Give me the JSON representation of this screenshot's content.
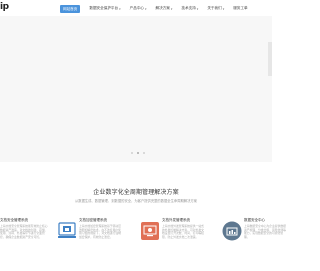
{
  "header": {
    "logo": "ip",
    "nav": [
      {
        "label": "网站首页",
        "active": true,
        "caret": false
      },
      {
        "label": "数据安全保护平台",
        "active": false,
        "caret": true
      },
      {
        "label": "产品中心",
        "active": false,
        "caret": true
      },
      {
        "label": "解决方案",
        "active": false,
        "caret": true
      },
      {
        "label": "技术支持",
        "active": false,
        "caret": true
      },
      {
        "label": "关于我们",
        "active": false,
        "caret": true
      },
      {
        "label": "服务工单",
        "active": false,
        "caret": false
      }
    ]
  },
  "banner": {
    "slide_count": 3,
    "active_slide": 1
  },
  "section": {
    "title": "企业数字化全周期管理解决方案",
    "subtitle": "从数据生成、数据管理、到数据的安全，为客户提供完整的数据全生命周期解决方案"
  },
  "products": [
    {
      "title": "文档安全管理系统",
      "desc": "上海文档安全管理系统能有效防止核心数据资产泄露，对文档的创建、存储、使用、流转、外发等环节进行全面管控，确保企业数据资产安全可控。",
      "icon": "none"
    },
    {
      "title": "文档加密管理系统",
      "desc": "上海文档加密管理系统基于驱动层透明加解密技术，在不改变用户使用习惯的前提下，对文档进行强制加密保护，有效防止泄密。",
      "icon": "document-lock-icon"
    },
    {
      "title": "文档外发管理系统",
      "desc": "上海文档外发管理系统提供一站式的外发控制解决方案，可对外发文档设置打开次数、时间、打印等权限，防止外发文档二次泄露。",
      "icon": "monitor-shield-icon"
    },
    {
      "title": "数据安全中心",
      "desc": "上海数据安全中心为企业提供数据资产梳理、分类分级、风险监测等能力，实现数据安全的可视化管理。",
      "icon": "chart-circle-icon"
    }
  ],
  "colors": {
    "accent": "#4a93dc",
    "icon_blue": "#3d7fc4",
    "icon_red": "#e07055",
    "icon_slate": "#5e7890"
  }
}
